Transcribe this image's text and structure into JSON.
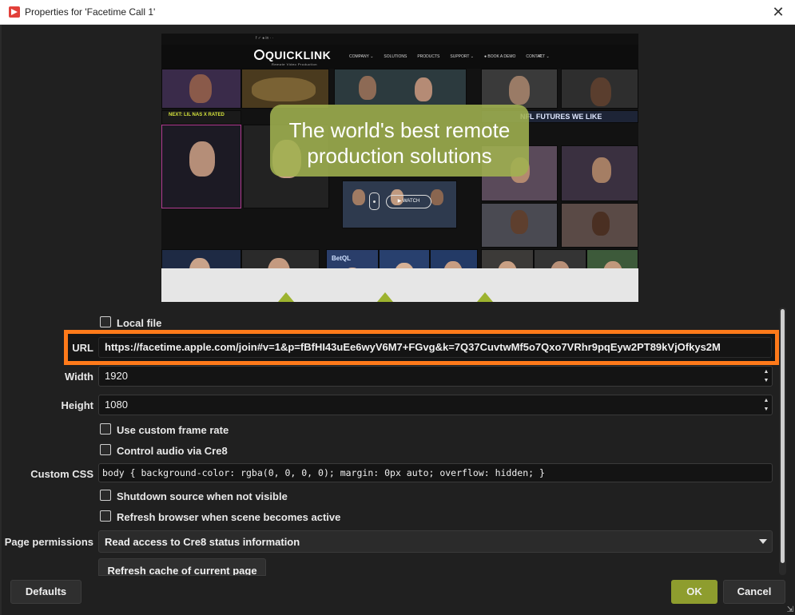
{
  "window": {
    "title": "Properties for 'Facetime Call 1'",
    "close_symbol": "✕"
  },
  "preview": {
    "nav_text": "f  ✓  ♠  in     ·     ·",
    "logo_text": "QUICKLINK",
    "logo_tag": "Remote Video Production",
    "menu": [
      "COMPANY ⌄",
      "SOLUTIONS",
      "PRODUCTS",
      "SUPPORT ⌄",
      "● BOOK A DEMO",
      "CONTACT ⌄"
    ],
    "banner_line1": "The world's best remote",
    "banner_line2": "production solutions",
    "watch_label": "▶ WATCH",
    "tile_caption_1": "NEXT: LIL NAS X RATED",
    "tile_caption_2": "NFL FUTURES WE LIKE",
    "tile_caption_3": "BetQL"
  },
  "form": {
    "local_file_label": "Local file",
    "url_label": "URL",
    "url_value": "https://facetime.apple.com/join#v=1&p=fBfHI43uEe6wyV6M7+FGvg&k=7Q37CuvtwMf5o7Qxo7VRhr9pqEyw2PT89kVjOfkys2M",
    "width_label": "Width",
    "width_value": "1920",
    "height_label": "Height",
    "height_value": "1080",
    "custom_frame_rate_label": "Use custom frame rate",
    "control_audio_label": "Control audio via Cre8",
    "custom_css_label": "Custom CSS",
    "custom_css_value": "body { background-color: rgba(0, 0, 0, 0); margin: 0px auto; overflow: hidden; }",
    "shutdown_label": "Shutdown source when not visible",
    "refresh_browser_label": "Refresh browser when scene becomes active",
    "page_permissions_label": "Page permissions",
    "page_permissions_value": "Read access to Cre8 status information",
    "refresh_cache_label": "Refresh cache of current page"
  },
  "footer": {
    "defaults_label": "Defaults",
    "ok_label": "OK",
    "cancel_label": "Cancel"
  },
  "colors": {
    "accent_ok": "#8e9d2e",
    "highlight": "#ff7a1a",
    "background": "#202020"
  }
}
